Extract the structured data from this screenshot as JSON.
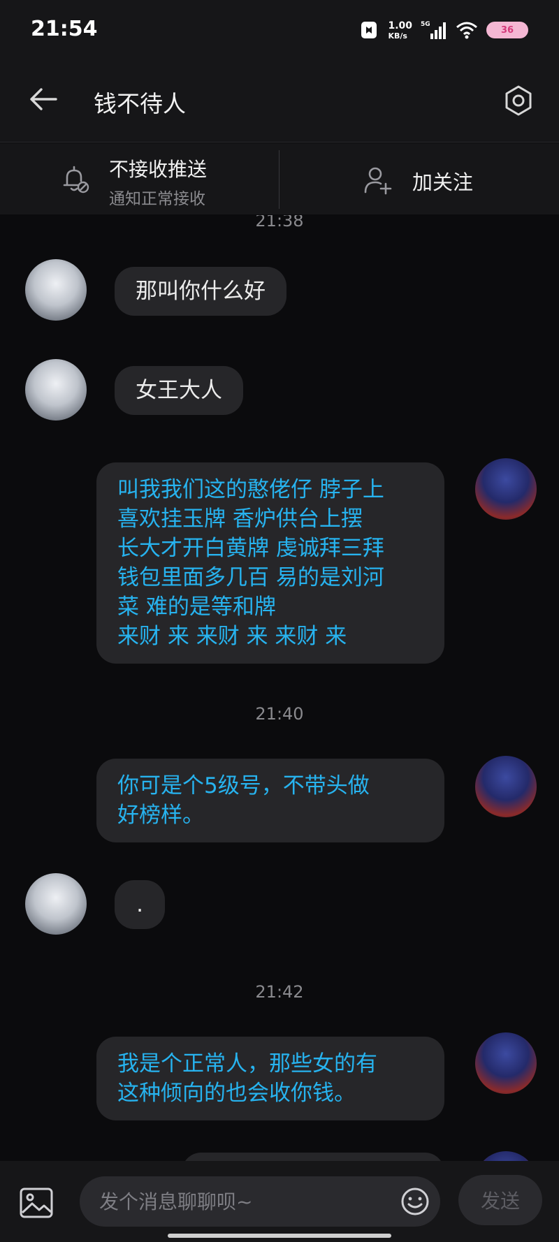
{
  "status_bar": {
    "time": "21:54",
    "net_speed_value": "1.00",
    "net_speed_unit": "KB/s",
    "network": "5G",
    "battery_badge": "36"
  },
  "header": {
    "title": "钱不待人",
    "back_icon": "arrow-left-icon",
    "settings_icon": "hexagon-settings-icon"
  },
  "action_bar": {
    "push_title": "不接收推送",
    "push_subtitle": "通知正常接收",
    "follow_label": "加关注"
  },
  "messages": [
    {
      "type": "timestamp",
      "text": "21:38"
    },
    {
      "type": "other",
      "text": "那叫你什么好"
    },
    {
      "type": "other",
      "text": "女王大人"
    },
    {
      "type": "me",
      "lines": [
        "叫我我们这的憨佬仔 脖子上",
        "喜欢挂玉牌 香炉供台上摆",
        "长大才开白黄牌 虔诚拜三拜",
        "钱包里面多几百 易的是刘河",
        "菜 难的是等和牌",
        "来财 来 来财 来 来财 来"
      ]
    },
    {
      "type": "timestamp",
      "text": "21:40"
    },
    {
      "type": "me",
      "lines": [
        "你可是个5级号，不带头做",
        "好榜样。"
      ]
    },
    {
      "type": "other",
      "text": "."
    },
    {
      "type": "timestamp",
      "text": "21:42"
    },
    {
      "type": "me",
      "lines": [
        "我是个正常人，那些女的有",
        "这种倾向的也会收你钱。"
      ]
    }
  ],
  "input_bar": {
    "placeholder": "发个消息聊聊呗~",
    "send_label": "发送"
  },
  "colors": {
    "background": "#0b0b0d",
    "bar": "#161618",
    "bubble": "#262629",
    "my_text": "#27b3ef",
    "other_text": "#ececec"
  }
}
